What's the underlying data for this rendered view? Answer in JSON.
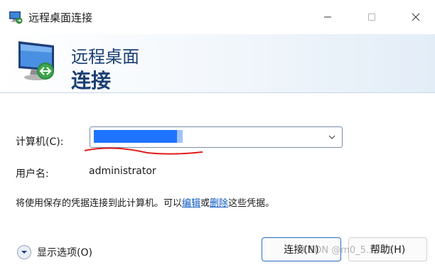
{
  "window": {
    "title": "远程桌面连接",
    "controls": {
      "minimize": "minimize-icon",
      "maximize": "maximize-icon",
      "close": "close-icon"
    }
  },
  "banner": {
    "line1": "远程桌面",
    "line2": "连接"
  },
  "form": {
    "computer_label": "计算机(C):",
    "computer_value": "",
    "user_label": "用户名:",
    "user_value": "administrator",
    "info_prefix": "将使用保存的凭据连接到此计算机。可以",
    "info_edit_link": "编辑",
    "info_middle": "或",
    "info_delete_link": "删除",
    "info_suffix": "这些凭据。"
  },
  "footer": {
    "show_options": "显示选项(O)",
    "connect_button": "连接(N)",
    "help_button": "帮助(H)"
  },
  "watermark": "CSDN @m0_5...322",
  "colors": {
    "banner_text": "#1a3f72",
    "link": "#0a57c2",
    "selection": "#1e73ff",
    "annotation": "#e01b1b"
  }
}
